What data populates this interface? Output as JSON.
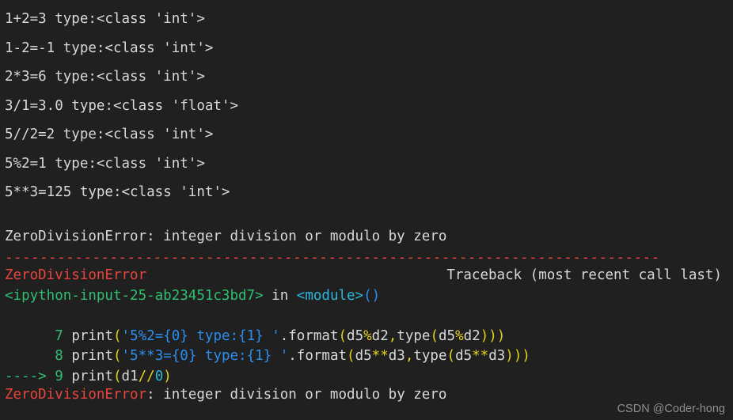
{
  "terminal": {
    "kind": "ipython-console",
    "background_color": "#202020",
    "default_text_color": "#d8d8d8",
    "output_lines": [
      "1+2=3 type:<class 'int'>",
      "1-2=-1 type:<class 'int'>",
      "2*3=6 type:<class 'int'>",
      "3/1=3.0 type:<class 'float'>",
      "5//2=2 type:<class 'int'>",
      "5%2=1 type:<class 'int'>",
      "5**3=125 type:<class 'int'>"
    ],
    "error_summary": "ZeroDivisionError: integer division or modulo by zero",
    "separator_rule": "---------------------------------------------------------------------------",
    "traceback": {
      "exception_name": "ZeroDivisionError",
      "header_right": "Traceback (most recent call last)",
      "location_file": "<ipython-input-25-ab23451c3bd7>",
      "location_in": "in",
      "location_scope": "<module>",
      "location_scope_parens": "()",
      "frames": [
        {
          "marker": "",
          "lineno": "7",
          "fn": "print",
          "open_paren": "(",
          "string": "'5%2={0} type:{1} '",
          "dot_format": ".format",
          "args_open": "(",
          "arg1_a": "d5",
          "arg1_op": "%",
          "arg1_b": "d2",
          "comma": ",",
          "arg2_fn": "type",
          "arg2_open": "(",
          "arg2_a": "d5",
          "arg2_op": "%",
          "arg2_b": "d2",
          "close": ")))"
        },
        {
          "marker": "",
          "lineno": "8",
          "fn": "print",
          "open_paren": "(",
          "string": "'5**3={0} type:{1} '",
          "dot_format": ".format",
          "args_open": "(",
          "arg1_a": "d5",
          "arg1_op": "**",
          "arg1_b": "d3",
          "comma": ",",
          "arg2_fn": "type",
          "arg2_open": "(",
          "arg2_a": "d5",
          "arg2_op": "**",
          "arg2_b": "d3",
          "close": ")))"
        }
      ],
      "current_frame": {
        "marker": "----> ",
        "lineno": "9",
        "fn": "print",
        "open_paren": "(",
        "arg_var": "d1",
        "arg_op": "//",
        "arg_num": "0",
        "close_paren": ")"
      }
    },
    "final_error": {
      "name": "ZeroDivisionError",
      "message": ": integer division or modulo by zero"
    },
    "colors": {
      "red": "#e8453c",
      "green": "#2fbf71",
      "cyan": "#29b8db",
      "blue": "#2b8fee",
      "yellow": "#e5d01a",
      "text": "#d8d8d8"
    }
  },
  "watermark": "CSDN @Coder-hong"
}
